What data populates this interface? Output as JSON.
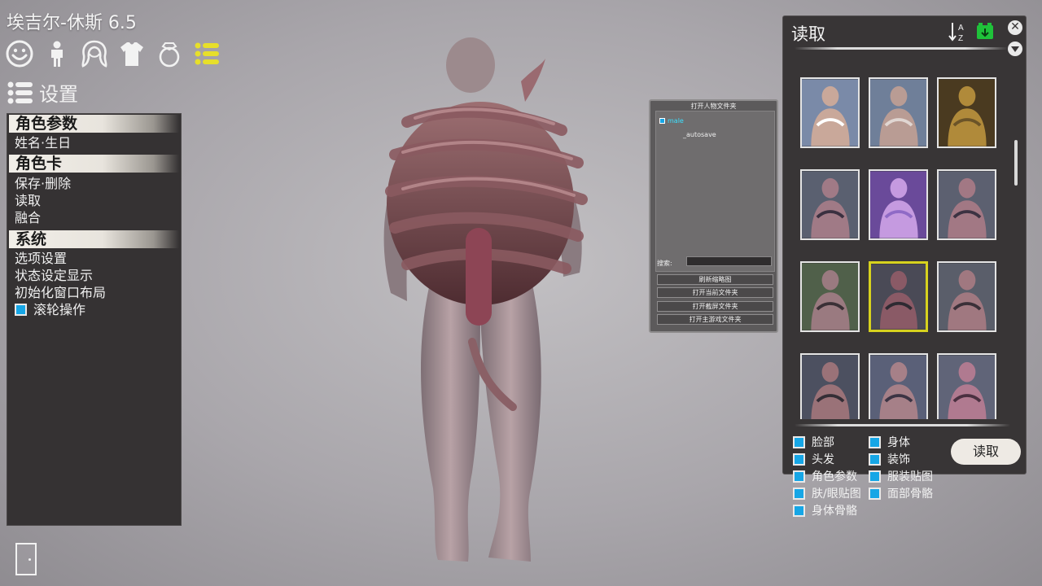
{
  "app": {
    "title": "埃吉尔-休斯 6.5"
  },
  "categories": [
    {
      "name": "face-icon"
    },
    {
      "name": "body-icon"
    },
    {
      "name": "hair-icon"
    },
    {
      "name": "clothing-icon"
    },
    {
      "name": "accessory-ring-icon"
    },
    {
      "name": "settings-list-icon"
    }
  ],
  "settings": {
    "title": "设置",
    "sections": [
      {
        "header": "角色参数",
        "items": [
          "姓名·生日"
        ]
      },
      {
        "header": "角色卡",
        "items": [
          "保存·删除",
          "读取",
          "融合"
        ]
      },
      {
        "header": "系统",
        "items": [
          "选项设置",
          "状态设定显示",
          "初始化窗口布局"
        ]
      }
    ],
    "scroll_toggle": {
      "label": "滚轮操作",
      "checked": true
    }
  },
  "folder_dialog": {
    "title": "打开人物文件夹",
    "tree": [
      {
        "label": "male"
      },
      {
        "label": "_autosave"
      }
    ],
    "search_label": "搜索:",
    "search_value": "",
    "buttons": [
      "刷新缩略图",
      "打开当前文件夹",
      "打开截屏文件夹",
      "打开主游戏文件夹"
    ]
  },
  "load_panel": {
    "title": "读取",
    "sort_icon": "sort-az-icon",
    "new_folder_icon": "folder-add-icon",
    "accent": "#16a6e6",
    "selected_color": "#d7d21e",
    "thumbnails": [
      {
        "name": "thumb-boy"
      },
      {
        "name": "thumb-old-man"
      },
      {
        "name": "thumb-golden-statue"
      },
      {
        "name": "thumb-monster-1"
      },
      {
        "name": "thumb-purple-tentacle"
      },
      {
        "name": "thumb-monster-2"
      },
      {
        "name": "thumb-monster-3"
      },
      {
        "name": "thumb-monster-selected",
        "selected": true
      },
      {
        "name": "thumb-monster-4"
      },
      {
        "name": "thumb-monster-5"
      },
      {
        "name": "thumb-monster-6"
      },
      {
        "name": "thumb-monster-7"
      }
    ],
    "options_left": [
      "脸部",
      "头发",
      "角色参数",
      "肤/眼贴图",
      "身体骨骼"
    ],
    "options_right": [
      "身体",
      "装饰",
      "服装贴图",
      "面部骨骼"
    ],
    "load_button": "读取"
  }
}
